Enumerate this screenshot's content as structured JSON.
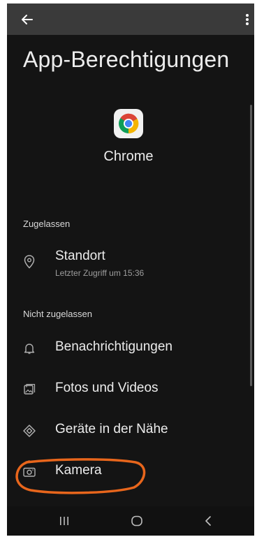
{
  "header": {
    "back_icon": "arrow-left-icon",
    "more_icon": "more-vert-icon",
    "title": "App-Berechtigungen"
  },
  "app": {
    "icon": "chrome-logo-icon",
    "name": "Chrome"
  },
  "sections": {
    "allowed": {
      "header": "Zugelassen",
      "items": [
        {
          "label": "Standort",
          "sublabel": "Letzter Zugriff um 15:36",
          "icon": "location-pin-icon"
        }
      ]
    },
    "denied": {
      "header": "Nicht zugelassen",
      "items": [
        {
          "label": "Benachrichtigungen",
          "icon": "bell-icon"
        },
        {
          "label": "Fotos und Videos",
          "icon": "photo-icon"
        },
        {
          "label": "Geräte in der Nähe",
          "icon": "nearby-devices-icon"
        },
        {
          "label": "Kamera",
          "icon": "camera-icon"
        }
      ]
    }
  },
  "navigation": {
    "recents_icon": "recents-icon",
    "home_icon": "home-icon",
    "back_icon": "back-chevron-icon"
  },
  "colors": {
    "background": "#141414",
    "status_bar": "#3a3a3a",
    "text": "#ececec",
    "secondary_text": "#9e9e9e",
    "icon": "#b0b0b0",
    "annotation": "#e8661c"
  }
}
